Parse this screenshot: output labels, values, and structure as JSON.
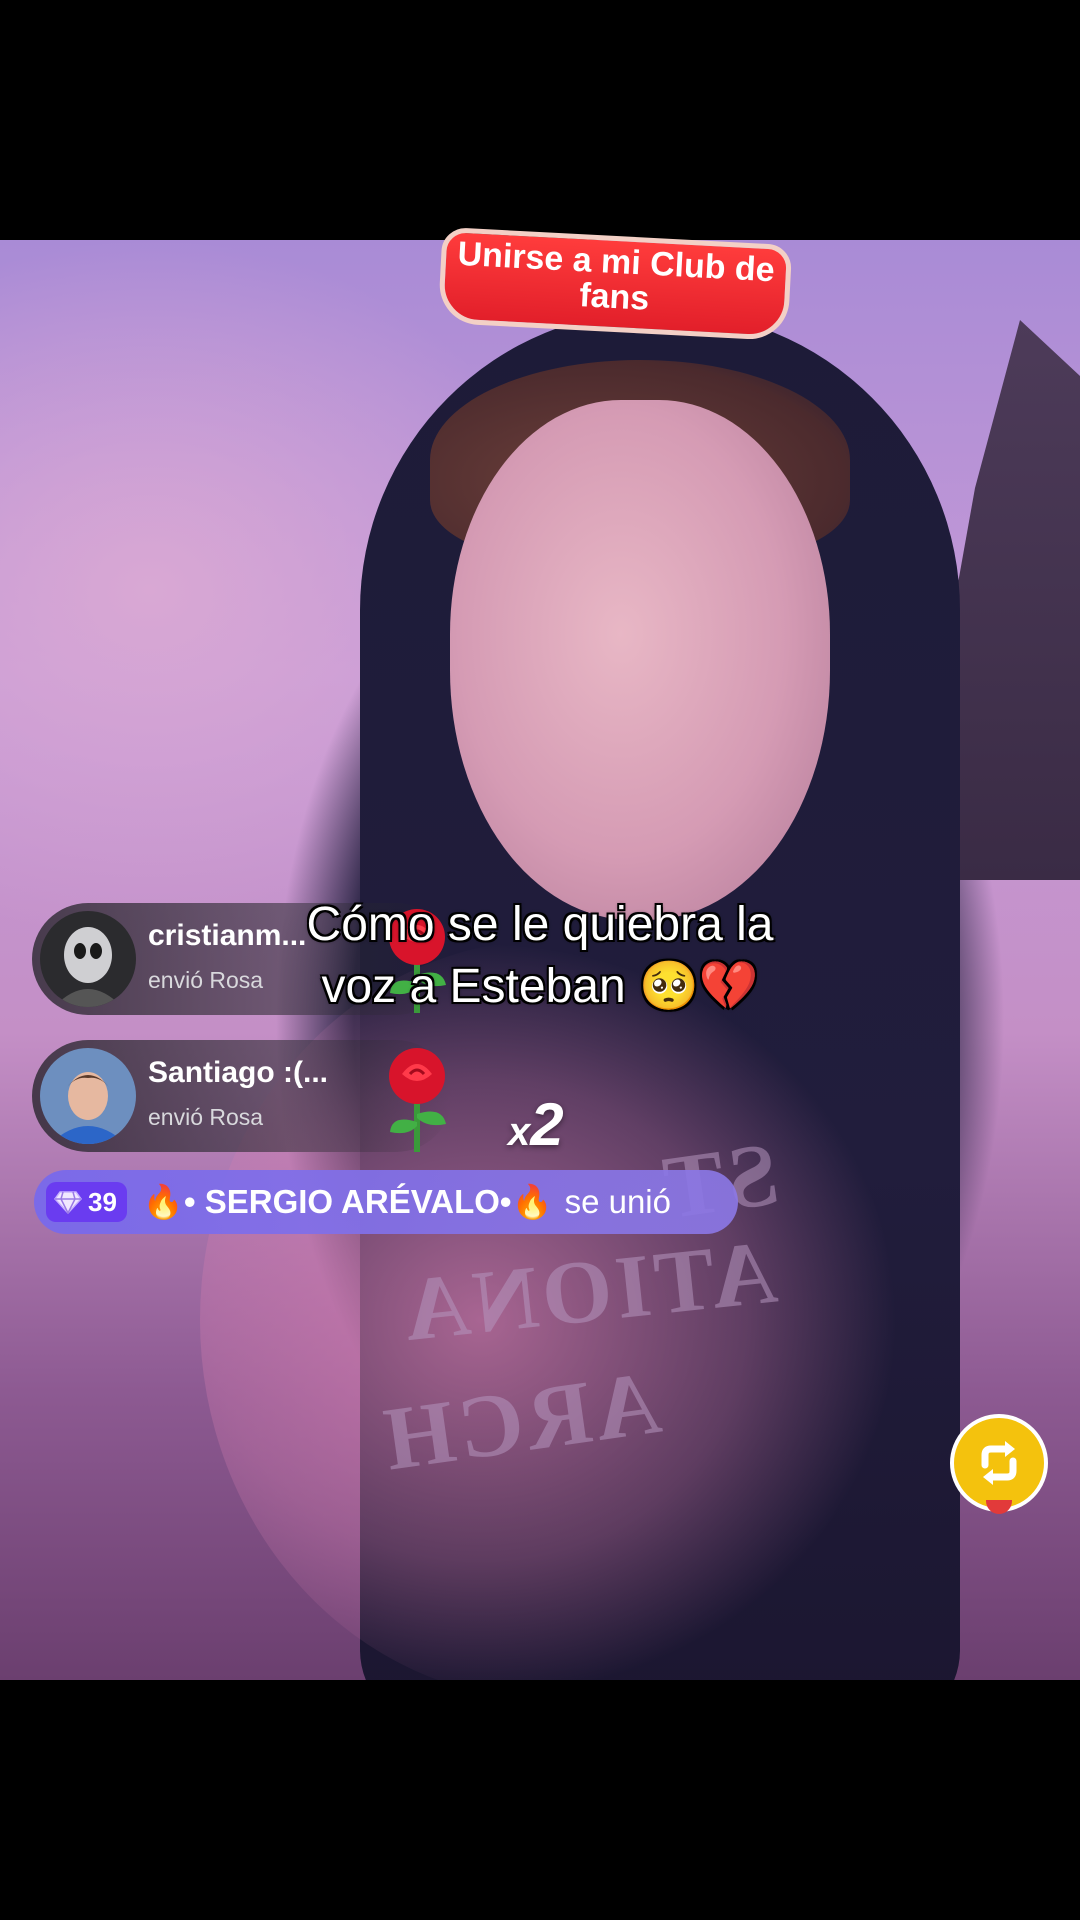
{
  "fan_club_banner": {
    "line1": "Unirse a mi Club de",
    "line2": "fans"
  },
  "gifts": [
    {
      "username": "cristianm...",
      "action": "envió Rosa",
      "gift_icon": "rose-icon"
    },
    {
      "username": "Santiago :(...",
      "action": "envió Rosa",
      "gift_icon": "rose-icon",
      "multiplier_prefix": "x",
      "multiplier_value": "2"
    }
  ],
  "joined": {
    "level": "39",
    "level_icon": "diamond-icon",
    "username": "🔥• SERGIO ARÉVALO•🔥",
    "action": "se unió"
  },
  "caption": {
    "line1": "Cómo se le quiebra la",
    "line2": "voz a Esteban 🥺💔"
  },
  "repost_button": {
    "icon": "repost-icon",
    "color": "#f4c20d"
  },
  "shirt_text": [
    "ST",
    "ATIONA",
    "ARCH"
  ]
}
